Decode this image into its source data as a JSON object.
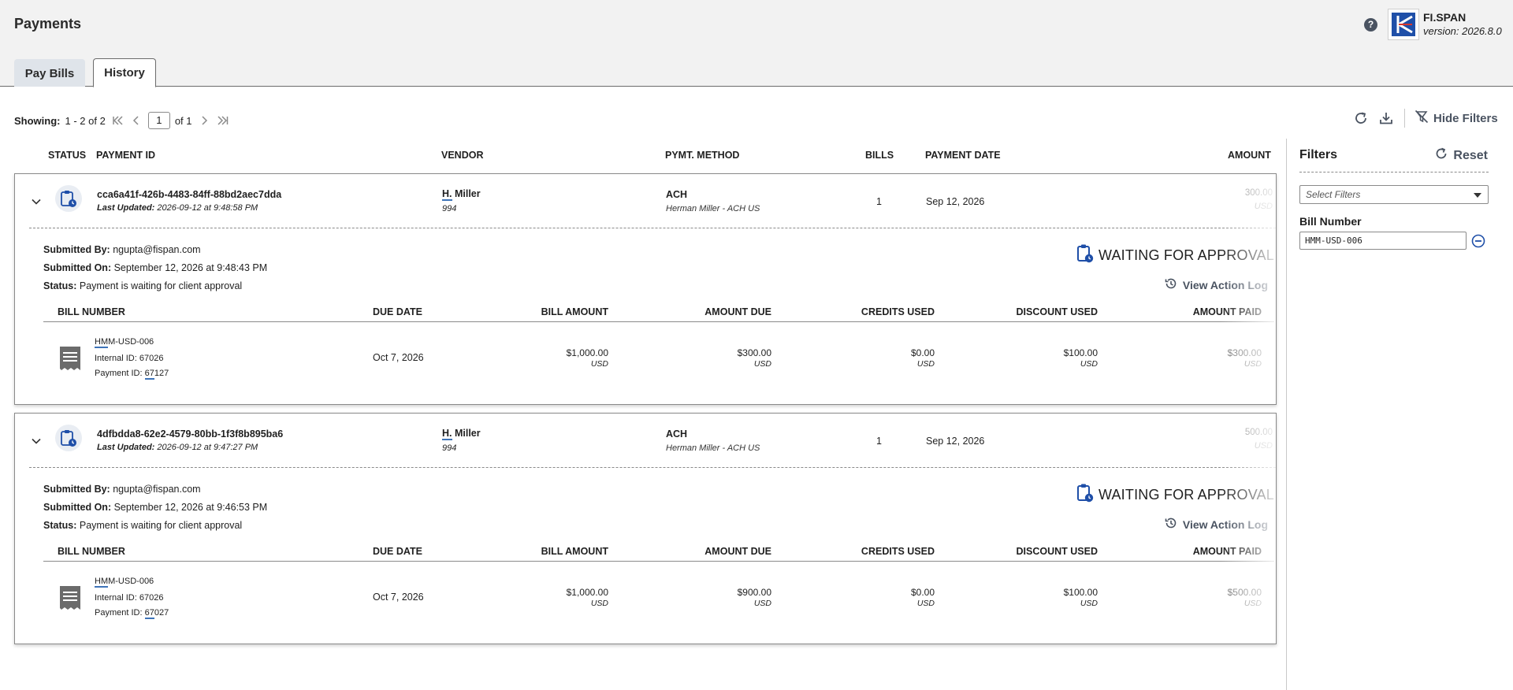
{
  "header": {
    "title": "Payments",
    "help_icon": "?",
    "brand_name": "FI.SPAN",
    "brand_version": "version: 2026.8.0"
  },
  "tabs": [
    {
      "label": "Pay Bills",
      "active": false
    },
    {
      "label": "History",
      "active": true
    }
  ],
  "pager": {
    "showing_label": "Showing:",
    "showing_range": "1 - 2 of 2",
    "current_page": "1",
    "of_pages": "of 1"
  },
  "toolbar": {
    "hide_filters": "Hide Filters"
  },
  "columns": {
    "status": "STATUS",
    "payment_id": "PAYMENT ID",
    "vendor": "VENDOR",
    "method": "PYMT. METHOD",
    "bills": "BILLS",
    "payment_date": "PAYMENT DATE",
    "amount": "AMOUNT"
  },
  "bill_columns": {
    "bill_number": "BILL NUMBER",
    "due_date": "DUE DATE",
    "bill_amount": "BILL AMOUNT",
    "amount_due": "AMOUNT DUE",
    "credits_used": "CREDITS USED",
    "discount_used": "DISCOUNT USED",
    "amount_paid": "AMOUNT PAID"
  },
  "labels": {
    "last_updated": "Last Updated:",
    "submitted_by": "Submitted By:",
    "submitted_on": "Submitted On:",
    "status": "Status:",
    "waiting": "WAITING FOR APPROVAL",
    "view_action_log": "View Action Log",
    "internal_id": "Internal ID:",
    "payment_id": "Payment ID:"
  },
  "payments": [
    {
      "id": "cca6a41f-426b-4483-84ff-88bd2aec7dda",
      "last_updated": "2026-09-12 at 9:48:58 PM",
      "vendor_initial": "H.",
      "vendor_rest": " Miller",
      "vendor_id": "994",
      "method": "ACH",
      "method_detail": "Herman Miller - ACH US",
      "bills": "1",
      "payment_date": "Sep 12, 2026",
      "amount": "300.00",
      "currency": "USD",
      "submitted_by": "ngupta@fispan.com",
      "submitted_on": "September 12, 2026 at 9:48:43 PM",
      "status_text": "Payment is waiting for client approval",
      "bill": {
        "number_prefix": "HM",
        "number_rest": "M-USD-006",
        "internal_id": "67026",
        "payment_id_prefix": "67",
        "payment_id_rest": "127",
        "due_date": "Oct 7, 2026",
        "bill_amount": "$1,000.00",
        "amount_due": "$300.00",
        "credits_used": "$0.00",
        "discount_used": "$100.00",
        "amount_paid": "$300.00",
        "currency": "USD"
      }
    },
    {
      "id": "4dfbdda8-62e2-4579-80bb-1f3f8b895ba6",
      "last_updated": "2026-09-12 at 9:47:27 PM",
      "vendor_initial": "H.",
      "vendor_rest": " Miller",
      "vendor_id": "994",
      "method": "ACH",
      "method_detail": "Herman Miller - ACH US",
      "bills": "1",
      "payment_date": "Sep 12, 2026",
      "amount": "500.00",
      "currency": "USD",
      "submitted_by": "ngupta@fispan.com",
      "submitted_on": "September 12, 2026 at 9:46:53 PM",
      "status_text": "Payment is waiting for client approval",
      "bill": {
        "number_prefix": "HM",
        "number_rest": "M-USD-006",
        "internal_id": "67026",
        "payment_id_prefix": "67",
        "payment_id_rest": "027",
        "due_date": "Oct 7, 2026",
        "bill_amount": "$1,000.00",
        "amount_due": "$900.00",
        "credits_used": "$0.00",
        "discount_used": "$100.00",
        "amount_paid": "$500.00",
        "currency": "USD"
      }
    }
  ],
  "filters": {
    "title": "Filters",
    "reset": "Reset",
    "select_placeholder": "Select Filters",
    "bill_number_label": "Bill Number",
    "bill_number_value": "HMM-USD-006"
  },
  "colors": {
    "accent": "#3d73b8",
    "status_icon": "#1f4fa8",
    "muted_text": "#4a5361"
  }
}
